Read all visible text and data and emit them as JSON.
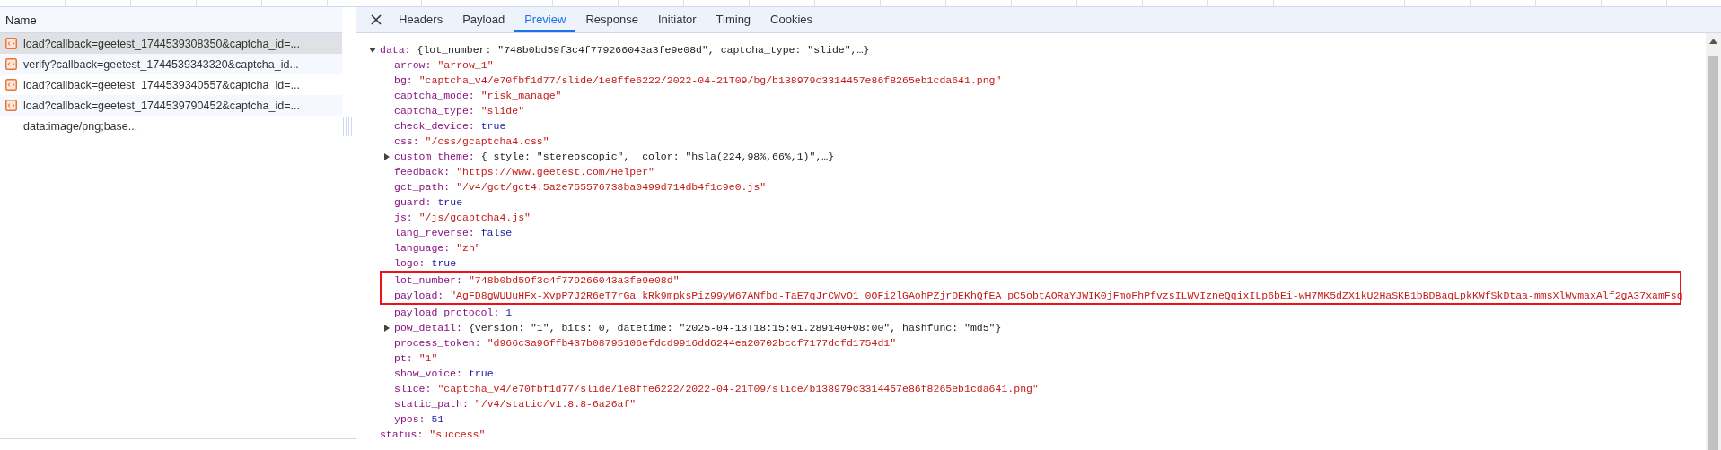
{
  "request_list": {
    "header": "Name",
    "items": [
      {
        "name": "load?callback=geetest_1744539308350&captcha_id=...",
        "kind": "script",
        "selected": true
      },
      {
        "name": "verify?callback=geetest_1744539343320&captcha_id...",
        "kind": "script",
        "selected": false
      },
      {
        "name": "load?callback=geetest_1744539340557&captcha_id=...",
        "kind": "script",
        "selected": false
      },
      {
        "name": "load?callback=geetest_1744539790452&captcha_id=...",
        "kind": "script",
        "selected": false
      },
      {
        "name": "data:image/png;base...",
        "kind": "data",
        "selected": false
      }
    ]
  },
  "detail_tabs": [
    {
      "label": "Headers",
      "selected": false
    },
    {
      "label": "Payload",
      "selected": false
    },
    {
      "label": "Preview",
      "selected": true
    },
    {
      "label": "Response",
      "selected": false
    },
    {
      "label": "Initiator",
      "selected": false
    },
    {
      "label": "Timing",
      "selected": false
    },
    {
      "label": "Cookies",
      "selected": false
    }
  ],
  "preview": [
    {
      "key": "data:",
      "kind": "object",
      "expanded": true,
      "value": "{lot_number: \"748b0bd59f3c4f779266043a3fe9e08d\", captcha_type: \"slide\",…}",
      "children": [
        {
          "key": "arrow:",
          "kind": "string",
          "value": "\"arrow_1\"",
          "highlighted": false
        },
        {
          "key": "bg:",
          "kind": "string",
          "value": "\"captcha_v4/e70fbf1d77/slide/1e8ffe6222/2022-04-21T09/bg/b138979c3314457e86f8265eb1cda641.png\"",
          "highlighted": false
        },
        {
          "key": "captcha_mode:",
          "kind": "string",
          "value": "\"risk_manage\"",
          "highlighted": false
        },
        {
          "key": "captcha_type:",
          "kind": "string",
          "value": "\"slide\"",
          "highlighted": false
        },
        {
          "key": "check_device:",
          "kind": "literal",
          "value": "true",
          "highlighted": false
        },
        {
          "key": "css:",
          "kind": "string",
          "value": "\"/css/gcaptcha4.css\"",
          "highlighted": false
        },
        {
          "key": "custom_theme:",
          "kind": "object",
          "expanded": false,
          "value": "{_style: \"stereoscopic\", _color: \"hsla(224,98%,66%,1)\",…}",
          "highlighted": false
        },
        {
          "key": "feedback:",
          "kind": "string",
          "value": "\"https://www.geetest.com/Helper\"",
          "highlighted": false
        },
        {
          "key": "gct_path:",
          "kind": "string",
          "value": "\"/v4/gct/gct4.5a2e755576738ba0499d714db4f1c9e0.js\"",
          "highlighted": false
        },
        {
          "key": "guard:",
          "kind": "literal",
          "value": "true",
          "highlighted": false
        },
        {
          "key": "js:",
          "kind": "string",
          "value": "\"/js/gcaptcha4.js\"",
          "highlighted": false
        },
        {
          "key": "lang_reverse:",
          "kind": "literal",
          "value": "false",
          "highlighted": false
        },
        {
          "key": "language:",
          "kind": "string",
          "value": "\"zh\"",
          "highlighted": false
        },
        {
          "key": "logo:",
          "kind": "literal",
          "value": "true",
          "highlighted": false
        },
        {
          "key": "lot_number:",
          "kind": "string",
          "value": "\"748b0bd59f3c4f779266043a3fe9e08d\"",
          "highlighted": true
        },
        {
          "key": "payload:",
          "kind": "string",
          "value": "\"AgFD8gWUUuHFx-XvpP7J2R6eT7rGa_kRk9mpksPiz99yW67ANfbd-TaE7qJrCWvO1_0OFi2lGAohPZjrDEKhQfEA_pC5obtAORaYJWIK0jFmoFhPfvzsILWVIzneQqixILp6bEi-wH7MK5dZX1kU2HaSKB1bBDBaqLpkKWfSkDtaa-mmsXlWvmaxAlf2gA37xamFsq",
          "highlighted": true
        },
        {
          "key": "payload_protocol:",
          "kind": "literal",
          "value": "1",
          "highlighted": false
        },
        {
          "key": "pow_detail:",
          "kind": "object",
          "expanded": false,
          "value": "{version: \"1\", bits: 0, datetime: \"2025-04-13T18:15:01.289140+08:00\", hashfunc: \"md5\"}",
          "highlighted": false
        },
        {
          "key": "process_token:",
          "kind": "string",
          "value": "\"d966c3a96ffb437b08795106efdcd9916dd6244ea20702bccf7177dcfd1754d1\"",
          "highlighted": false
        },
        {
          "key": "pt:",
          "kind": "string",
          "value": "\"1\"",
          "highlighted": false
        },
        {
          "key": "show_voice:",
          "kind": "literal",
          "value": "true",
          "highlighted": false
        },
        {
          "key": "slice:",
          "kind": "string",
          "value": "\"captcha_v4/e70fbf1d77/slide/1e8ffe6222/2022-04-21T09/slice/b138979c3314457e86f8265eb1cda641.png\"",
          "highlighted": false
        },
        {
          "key": "static_path:",
          "kind": "string",
          "value": "\"/v4/static/v1.8.8-6a26af\"",
          "highlighted": false
        },
        {
          "key": "ypos:",
          "kind": "literal",
          "value": "51",
          "highlighted": false
        }
      ]
    },
    {
      "key": "status:",
      "kind": "string",
      "value": "\"success\""
    }
  ]
}
